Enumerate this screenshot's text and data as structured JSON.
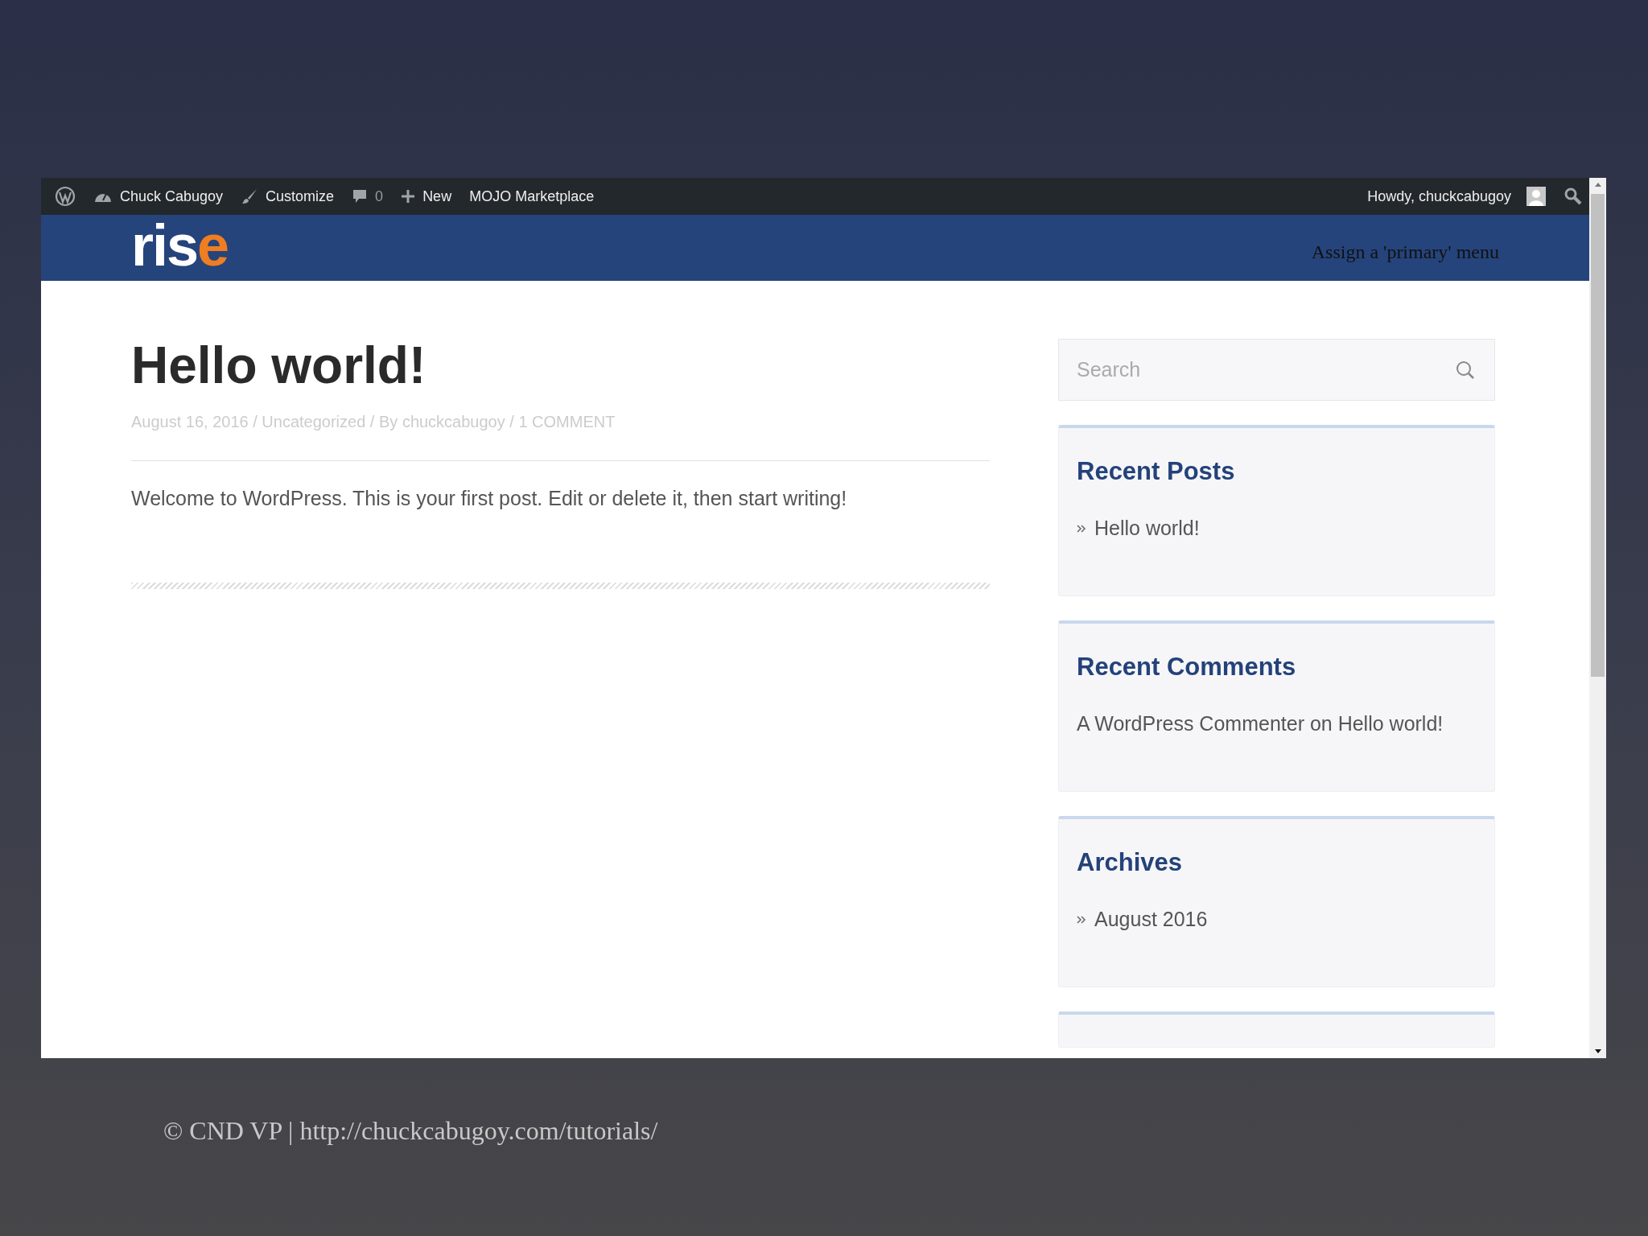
{
  "admin_bar": {
    "items": [
      {
        "kind": "wordpress"
      },
      {
        "kind": "site",
        "label": "Chuck Cabugoy"
      },
      {
        "kind": "customize",
        "label": "Customize"
      },
      {
        "kind": "comments",
        "label": "0"
      },
      {
        "kind": "new",
        "label": "New"
      },
      {
        "kind": "plain",
        "label": "MOJO Marketplace"
      }
    ],
    "account": "Howdy, chuckcabugoy"
  },
  "header": {
    "logo": {
      "text": "ris",
      "accent": "e"
    },
    "menu_notice": "Assign a 'primary' menu"
  },
  "post": {
    "title": "Hello world!",
    "meta": "August 16, 2016 / Uncategorized / By chuckcabugoy / 1 COMMENT",
    "body": "Welcome to WordPress. This is your first post. Edit or delete it, then start writing!"
  },
  "sidebar": {
    "search": {
      "placeholder": "Search"
    },
    "widgets": [
      {
        "title": "Recent Posts",
        "kind": "list",
        "items": [
          "Hello world!"
        ]
      },
      {
        "title": "Recent Comments",
        "kind": "text",
        "items": [
          "A WordPress Commenter on Hello world!"
        ]
      },
      {
        "title": "Archives",
        "kind": "list",
        "items": [
          "August 2016"
        ]
      }
    ]
  },
  "footer": "© CND VP | http://chuckcabugoy.com/tutorials/"
}
